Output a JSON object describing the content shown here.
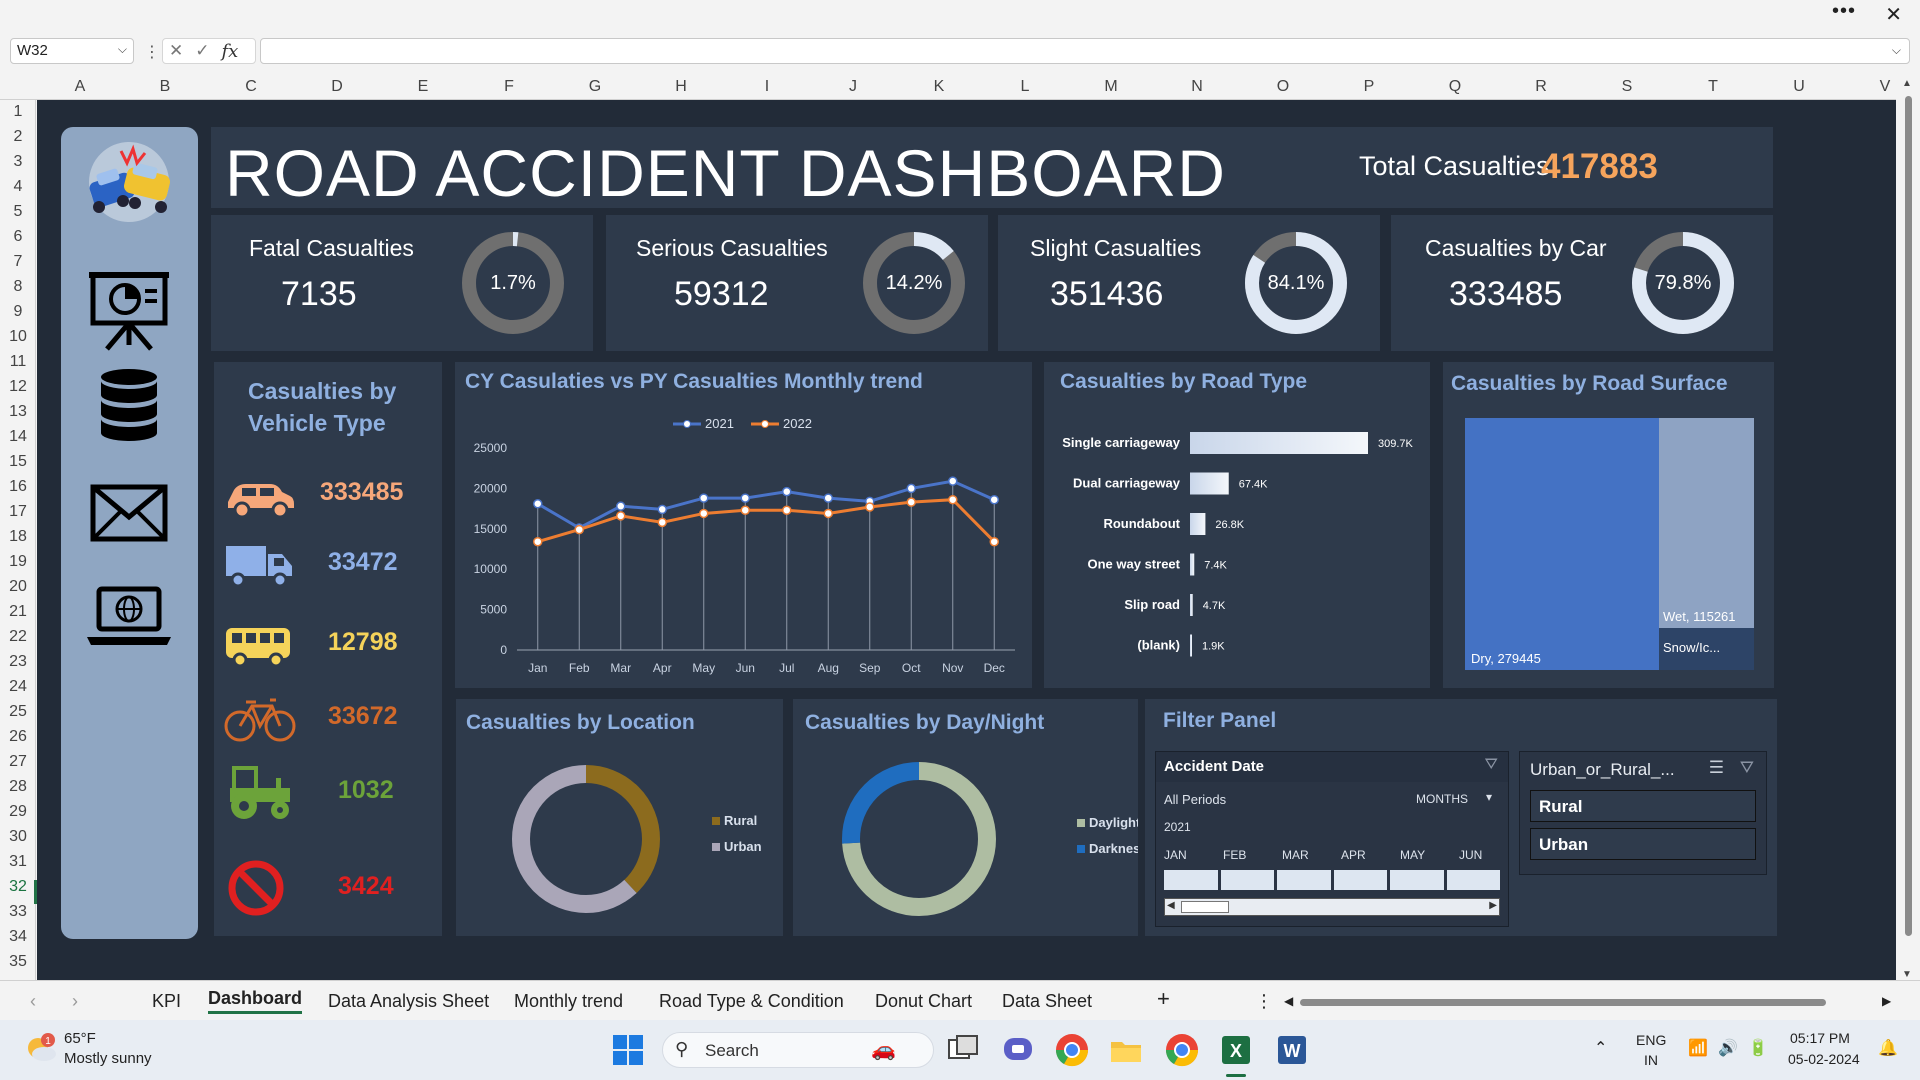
{
  "excel": {
    "name_box": "W32",
    "fx": "fx",
    "columns": [
      "A",
      "B",
      "C",
      "D",
      "E",
      "F",
      "G",
      "H",
      "I",
      "J",
      "K",
      "L",
      "M",
      "N",
      "O",
      "P",
      "Q",
      "R",
      "S",
      "T",
      "U",
      "V"
    ],
    "rows": [
      "1",
      "2",
      "3",
      "4",
      "5",
      "6",
      "7",
      "8",
      "9",
      "10",
      "11",
      "12",
      "13",
      "14",
      "15",
      "16",
      "17",
      "18",
      "19",
      "20",
      "21",
      "22",
      "23",
      "24",
      "25",
      "26",
      "27",
      "28",
      "29",
      "30",
      "31",
      "32",
      "33",
      "34",
      "35"
    ],
    "selected_row": "32"
  },
  "dashboard": {
    "title": "ROAD ACCIDENT DASHBOARD",
    "total_label": "Total Casualties",
    "total_value": "417883",
    "kpis": [
      {
        "label": "Fatal Casualties",
        "value": "7135",
        "pct": "1.7%",
        "fraction": 0.017
      },
      {
        "label": "Serious Casualties",
        "value": "59312",
        "pct": "14.2%",
        "fraction": 0.142
      },
      {
        "label": "Slight Casualties",
        "value": "351436",
        "pct": "84.1%",
        "fraction": 0.841
      },
      {
        "label": "Casualties by Car",
        "value": "333485",
        "pct": "79.8%",
        "fraction": 0.798
      }
    ],
    "vehicle": {
      "title_line1": "Casualties by",
      "title_line2": "Vehicle Type",
      "items": [
        {
          "icon": "car-icon",
          "value": "333485",
          "color": "#f6a77a"
        },
        {
          "icon": "truck-icon",
          "value": "33472",
          "color": "#8fb0e8"
        },
        {
          "icon": "bus-icon",
          "value": "12798",
          "color": "#f5d35a"
        },
        {
          "icon": "bicycle-icon",
          "value": "33672",
          "color": "#d2692a"
        },
        {
          "icon": "tractor-icon",
          "value": "1032",
          "color": "#6ca33a"
        },
        {
          "icon": "no-entry-icon",
          "value": "3424",
          "color": "#e02020"
        }
      ]
    },
    "trend": {
      "title": "CY Casulaties vs PY Casualties Monthly trend"
    },
    "roadtype": {
      "title": "Casualties by Road Type"
    },
    "surface": {
      "title": "Casualties by Road Surface"
    },
    "location": {
      "title": "Casualties by Location"
    },
    "daynight": {
      "title": "Casualties by Day/Night"
    },
    "filter": {
      "title": "Filter Panel",
      "timeline": {
        "header": "Accident Date",
        "periods": "All Periods",
        "unit": "MONTHS",
        "year": "2021",
        "months": [
          "JAN",
          "FEB",
          "MAR",
          "APR",
          "MAY",
          "JUN"
        ]
      },
      "slicer": {
        "header": "Urban_or_Rural_...",
        "items": [
          "Rural",
          "Urban"
        ]
      }
    }
  },
  "chart_data": [
    {
      "type": "line",
      "title": "CY Casulaties vs PY Casualties Monthly trend",
      "x": [
        "Jan",
        "Feb",
        "Mar",
        "Apr",
        "May",
        "Jun",
        "Jul",
        "Aug",
        "Sep",
        "Oct",
        "Nov",
        "Dec"
      ],
      "series": [
        {
          "name": "2021",
          "color": "#4a74c9",
          "values": [
            18100,
            15100,
            17800,
            17400,
            18800,
            18800,
            19600,
            18800,
            18400,
            20000,
            20900,
            18600
          ]
        },
        {
          "name": "2022",
          "color": "#ed7d31",
          "values": [
            13400,
            14900,
            16600,
            15800,
            16900,
            17300,
            17300,
            16900,
            17700,
            18300,
            18600,
            13400
          ]
        }
      ],
      "ylim": [
        0,
        25000
      ],
      "yticks": [
        "0",
        "5000",
        "10000",
        "15000",
        "20000",
        "25000"
      ]
    },
    {
      "type": "bar",
      "title": "Casualties by Road Type",
      "categories": [
        "Single carriageway",
        "Dual carriageway",
        "Roundabout",
        "One way street",
        "Slip road",
        "(blank)"
      ],
      "values": [
        309.7,
        67.4,
        26.8,
        7.4,
        4.7,
        1.9
      ],
      "labels": [
        "309.7K",
        "67.4K",
        "26.8K",
        "7.4K",
        "4.7K",
        "1.9K"
      ]
    },
    {
      "type": "heatmap",
      "title": "Casualties by Road Surface",
      "categories": [
        "Dry",
        "Wet",
        "Snow/Ic..."
      ],
      "values": [
        279445,
        115261,
        null
      ],
      "labels": [
        "Dry, 279445",
        "Wet, 115261",
        "Snow/Ic..."
      ]
    },
    {
      "type": "pie",
      "title": "Casualties by Location",
      "categories": [
        "Rural",
        "Urban"
      ],
      "values": [
        0.38,
        0.62
      ],
      "colors": [
        "#8c6b1e",
        "#aaa6b8"
      ]
    },
    {
      "type": "pie",
      "title": "Casualties by Day/Night",
      "categories": [
        "Daylight",
        "Darkness"
      ],
      "values": [
        0.74,
        0.26
      ],
      "colors": [
        "#aebda2",
        "#1f6dbf"
      ]
    }
  ],
  "tabs": {
    "items": [
      "KPI",
      "Dashboard",
      "Data Analysis Sheet",
      "Monthly trend",
      "Road Type & Condition",
      "Donut Chart",
      "Data Sheet"
    ],
    "active": "Dashboard",
    "add": "+"
  },
  "taskbar": {
    "weather_temp": "65°F",
    "weather_desc": "Mostly sunny",
    "weather_badge": "1",
    "search": "Search",
    "lang1": "ENG",
    "lang2": "IN",
    "time": "05:17 PM",
    "date": "05-02-2024"
  }
}
